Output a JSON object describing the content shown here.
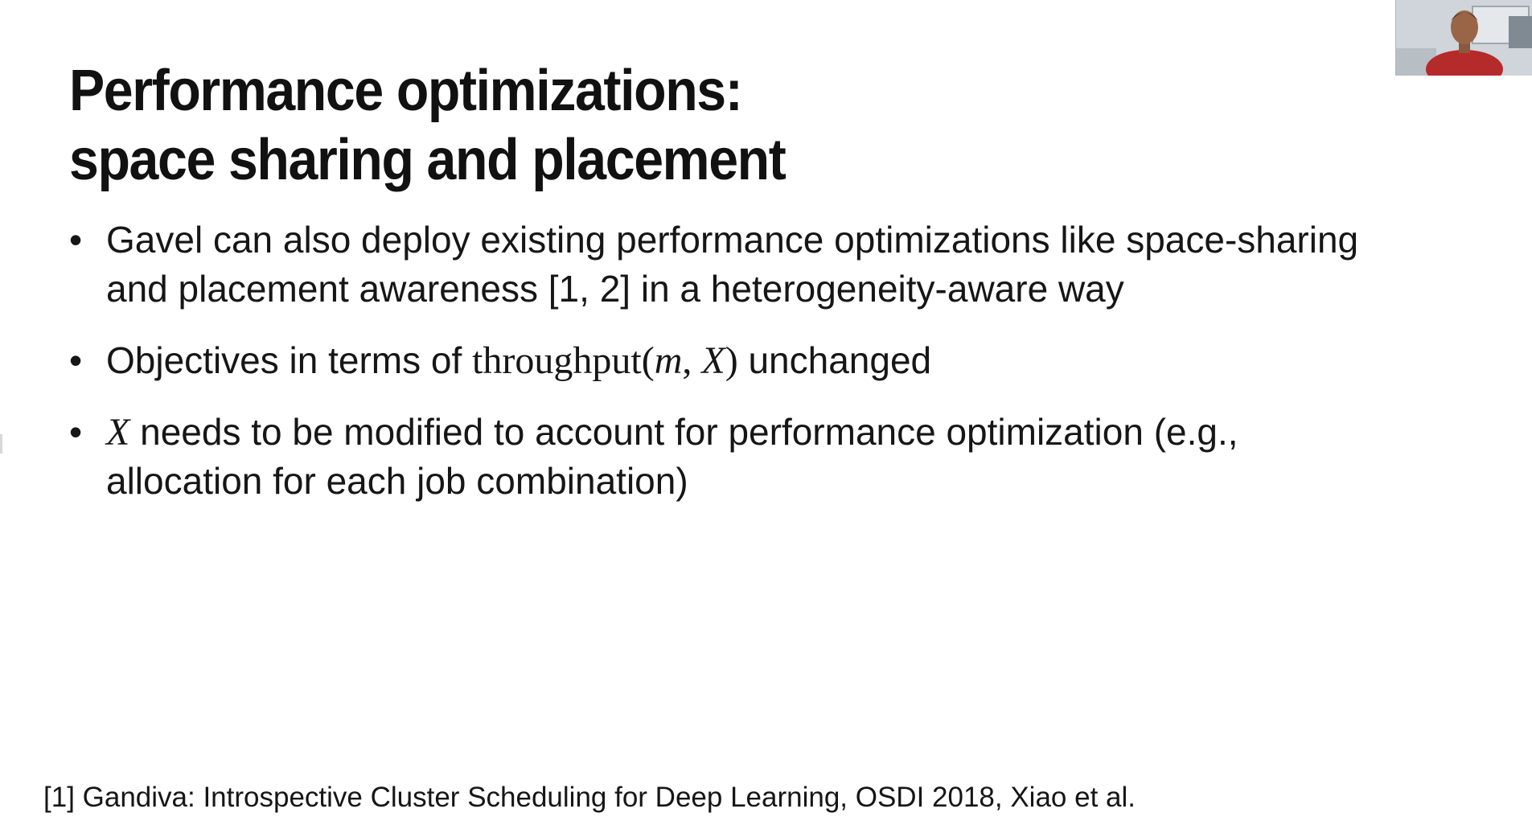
{
  "slide": {
    "title_lines": [
      "Performance optimizations:",
      "space sharing and placement"
    ],
    "bullets": [
      {
        "text": "Gavel can also deploy existing performance optimizations like space-sharing and placement awareness [1, 2] in a heterogeneity-aware way"
      },
      {
        "prefix": "Objectives in terms of ",
        "math_fn": "throughput",
        "math_open": "(",
        "math_arg1": "m",
        "math_sep": ", ",
        "math_arg2": "X",
        "math_close": ")",
        "suffix": " unchanged"
      },
      {
        "math_var": "X",
        "suffix": " needs to be modified to account for performance optimization (e.g., allocation for each job combination)"
      }
    ],
    "bullet_glyph": "•",
    "footnote": "[1] Gandiva: Introspective Cluster Scheduling for Deep Learning, OSDI 2018, Xiao et al."
  },
  "colors": {
    "text": "#111111",
    "background": "#ffffff",
    "speaker_shirt": "#b52a2a"
  },
  "icons": {
    "webcam": "speaker-video-feed"
  }
}
